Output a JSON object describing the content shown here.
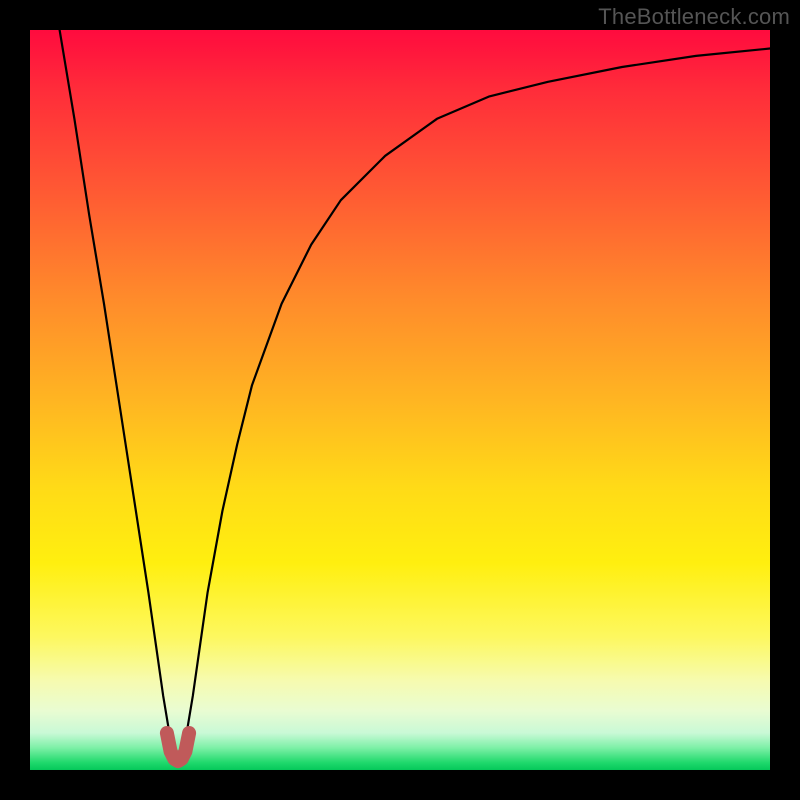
{
  "watermark": "TheBottleneck.com",
  "chart_data": {
    "type": "line",
    "title": "",
    "xlabel": "",
    "ylabel": "",
    "xlim": [
      0,
      100
    ],
    "ylim": [
      0,
      100
    ],
    "grid": false,
    "legend": false,
    "optimal_x": 20,
    "background_gradient_stops": [
      {
        "pos": 0,
        "color": "#ff0b3e"
      },
      {
        "pos": 22,
        "color": "#ff5a33"
      },
      {
        "pos": 50,
        "color": "#ffb522"
      },
      {
        "pos": 72,
        "color": "#ffef0f"
      },
      {
        "pos": 92,
        "color": "#e9fcd2"
      },
      {
        "pos": 100,
        "color": "#05c85a"
      }
    ],
    "series": [
      {
        "name": "bottleneck-curve",
        "x": [
          4,
          6,
          8,
          10,
          12,
          14,
          16,
          17,
          18,
          19,
          20,
          21,
          22,
          23,
          24,
          26,
          28,
          30,
          34,
          38,
          42,
          48,
          55,
          62,
          70,
          80,
          90,
          100
        ],
        "y": [
          100,
          88,
          75,
          63,
          50,
          37,
          24,
          17,
          10,
          4,
          2,
          4,
          10,
          17,
          24,
          35,
          44,
          52,
          63,
          71,
          77,
          83,
          88,
          91,
          93,
          95,
          96.5,
          97.5
        ]
      },
      {
        "name": "sweet-spot-marker",
        "x": [
          18.5,
          19,
          19.5,
          20,
          20.5,
          21,
          21.5
        ],
        "y": [
          5,
          2.5,
          1.5,
          1.2,
          1.5,
          2.5,
          5
        ]
      }
    ]
  }
}
